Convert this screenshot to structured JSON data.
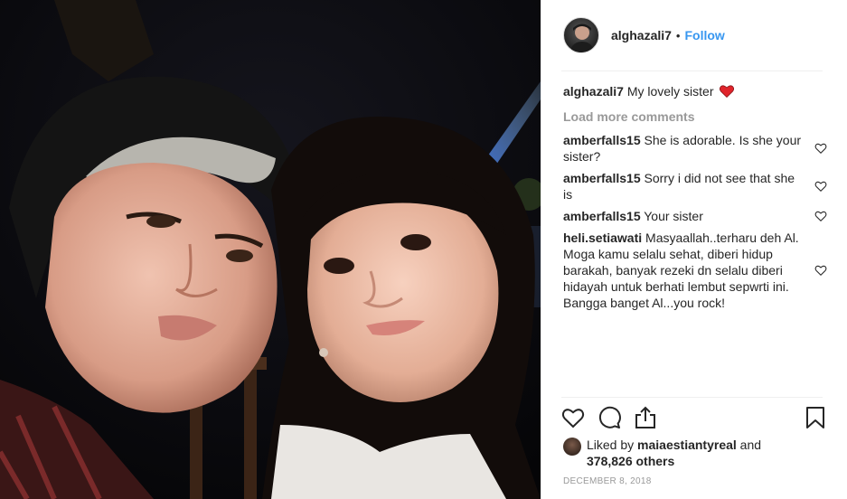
{
  "post": {
    "author": "alghazali7",
    "separator": "•",
    "follow_label": "Follow",
    "caption_user": "alghazali7",
    "caption_text": "My lovely sister",
    "load_more": "Load more comments",
    "comments": [
      {
        "user": "amberfalls15",
        "text": "She is adorable. Is she your sister?"
      },
      {
        "user": "amberfalls15",
        "text": "Sorry i did not see that she is"
      },
      {
        "user": "amberfalls15",
        "text": "Your sister"
      },
      {
        "user": "heli.setiawati",
        "text": "Masyaallah..terharu deh Al. Moga kamu selalu sehat, diberi hidup barakah, banyak rezeki dn selalu diberi hidayah untuk berhati lembut sepwrti ini. Bangga banget Al...you rock!"
      }
    ],
    "liked_by_prefix": "Liked by",
    "liked_by_user": "maiaestiantyreal",
    "liked_by_and": "and",
    "liked_by_others": "378,826 others",
    "date": "DECEMBER 8, 2018"
  },
  "icons": {
    "caption_emoji": "red-heart-icon",
    "comment_like": "heart-outline-icon",
    "like": "heart-outline-icon",
    "comment": "comment-bubble-icon",
    "share": "share-icon",
    "save": "bookmark-icon"
  },
  "colors": {
    "link": "#3897f0",
    "muted": "#999999",
    "text": "#262626",
    "emoji_heart": "#e0242b"
  }
}
